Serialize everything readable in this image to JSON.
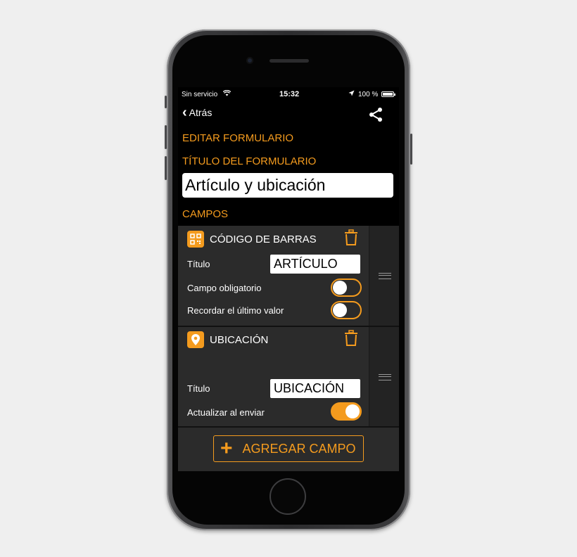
{
  "status_bar": {
    "carrier": "Sin servicio",
    "time": "15:32",
    "battery": "100 %"
  },
  "nav": {
    "back_label": "Atrás"
  },
  "form": {
    "section_title": "EDITAR FORMULARIO",
    "title_label": "TÍTULO DEL FORMULARIO",
    "title_value": "Artículo y ubicación",
    "fields_label": "CAMPOS"
  },
  "fields": [
    {
      "type_label": "CÓDIGO DE BARRAS",
      "icon": "qr-code-icon",
      "title_label": "Título",
      "title_value": "ARTÍCULO",
      "options": [
        {
          "label": "Campo obligatorio",
          "on": false
        },
        {
          "label": "Recordar el último valor",
          "on": false
        }
      ]
    },
    {
      "type_label": "UBICACIÓN",
      "icon": "location-pin-icon",
      "title_label": "Título",
      "title_value": "UBICACIÓN",
      "options": [
        {
          "label": "Actualizar al enviar",
          "on": true
        }
      ]
    }
  ],
  "add_field_label": "AGREGAR CAMPO",
  "colors": {
    "accent": "#f49b1e",
    "panel": "#2b2b2b",
    "background": "#000000"
  }
}
